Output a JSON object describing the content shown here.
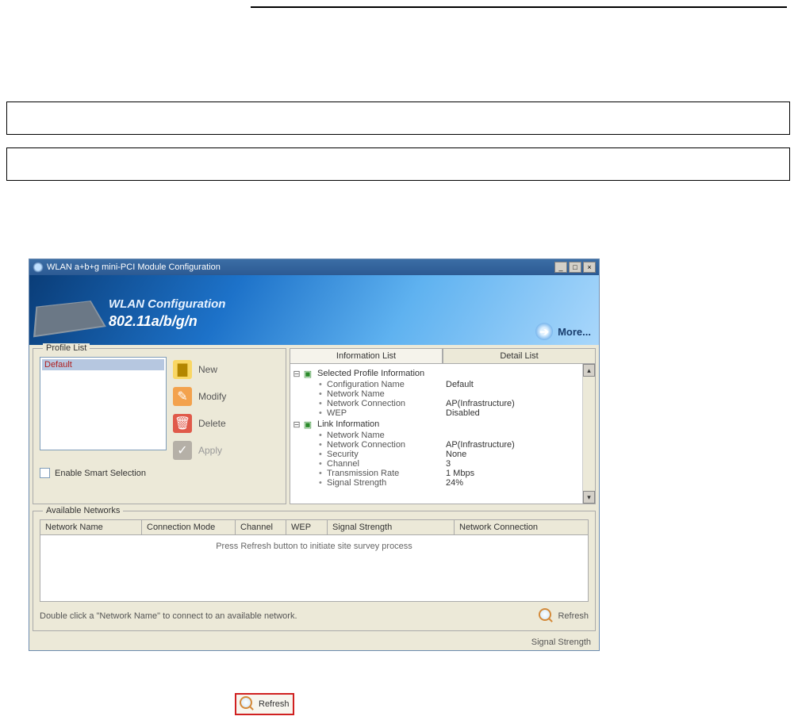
{
  "window": {
    "title": "WLAN a+b+g mini-PCI Module Configuration"
  },
  "banner": {
    "line1": "WLAN Configuration",
    "line2": "802.11a/b/g/n",
    "more": "More..."
  },
  "profile": {
    "legend": "Profile List",
    "selected_item": "Default",
    "buttons": {
      "new": "New",
      "modify": "Modify",
      "delete": "Delete",
      "apply": "Apply"
    },
    "smart_label": "Enable Smart Selection"
  },
  "tabs": {
    "info": "Information List",
    "detail": "Detail List"
  },
  "info_tree": {
    "section1": "Selected Profile Information",
    "rows1": [
      {
        "k": "Configuration Name",
        "v": "Default"
      },
      {
        "k": "Network Name",
        "v": ""
      },
      {
        "k": "Network Connection",
        "v": "AP(Infrastructure)"
      },
      {
        "k": "WEP",
        "v": "Disabled"
      }
    ],
    "section2": "Link Information",
    "rows2": [
      {
        "k": "Network Name",
        "v": ""
      },
      {
        "k": "Network Connection",
        "v": "AP(Infrastructure)"
      },
      {
        "k": "Security",
        "v": "None"
      },
      {
        "k": "Channel",
        "v": "3"
      },
      {
        "k": "Transmission Rate",
        "v": "1 Mbps"
      },
      {
        "k": "Signal Strength",
        "v": "24%"
      }
    ]
  },
  "available": {
    "legend": "Available Networks",
    "headers": [
      "Network Name",
      "Connection Mode",
      "Channel",
      "WEP",
      "Signal Strength",
      "Network Connection"
    ],
    "empty_msg": "Press Refresh button to initiate site survey process",
    "hint": "Double click a \"Network Name\" to connect to an available network.",
    "refresh": "Refresh"
  },
  "footer": {
    "signal_label": "Signal Strength"
  },
  "highlight": {
    "refresh": "Refresh"
  }
}
